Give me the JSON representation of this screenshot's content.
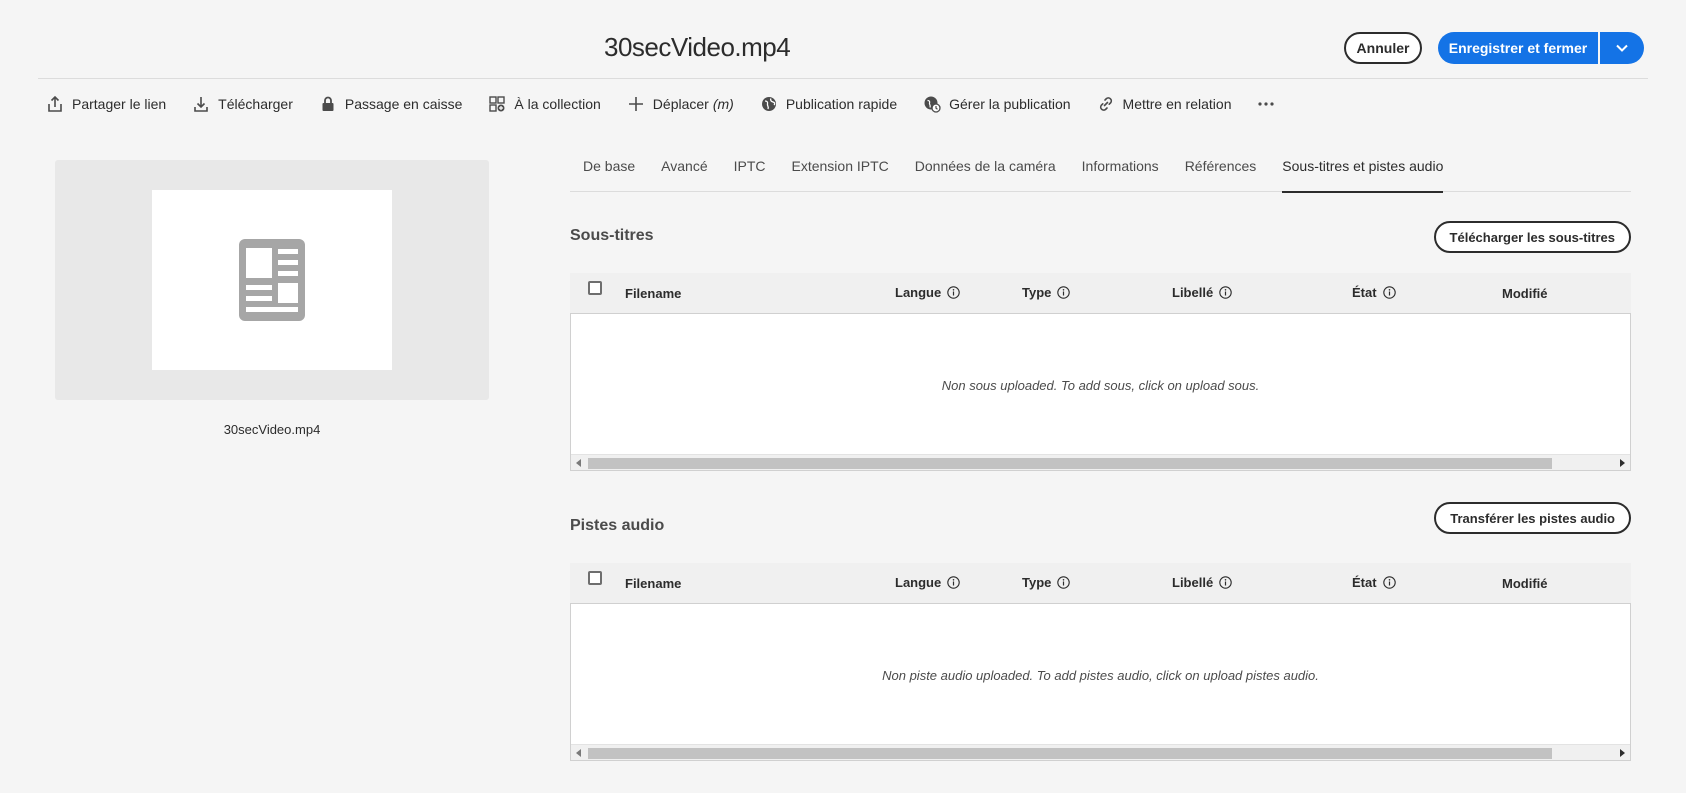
{
  "header": {
    "title": "30secVideo.mp4",
    "cancel_label": "Annuler",
    "save_label": "Enregistrer et fermer"
  },
  "toolbar": {
    "items": [
      {
        "label": "Partager le lien",
        "icon": "share-icon"
      },
      {
        "label": "Télécharger",
        "icon": "download-icon"
      },
      {
        "label": "Passage en caisse",
        "icon": "lock-icon"
      },
      {
        "label": "À la collection",
        "icon": "collection-add-icon"
      },
      {
        "label": "Déplacer",
        "shortcut": "(m)",
        "icon": "move-icon"
      },
      {
        "label": "Publication rapide",
        "icon": "globe-icon"
      },
      {
        "label": "Gérer la publication",
        "icon": "globe-clock-icon"
      },
      {
        "label": "Mettre en relation",
        "icon": "link-icon"
      }
    ],
    "more_icon": "more-icon"
  },
  "preview": {
    "filename": "30secVideo.mp4",
    "icon": "document-icon"
  },
  "tabs": [
    {
      "label": "De base"
    },
    {
      "label": "Avancé"
    },
    {
      "label": "IPTC"
    },
    {
      "label": "Extension IPTC"
    },
    {
      "label": "Données de la caméra"
    },
    {
      "label": "Informations"
    },
    {
      "label": "Références"
    },
    {
      "label": "Sous-titres et pistes audio",
      "active": true
    }
  ],
  "subtitles": {
    "title": "Sous-titres",
    "upload_label": "Télécharger les sous-titres",
    "columns": [
      "Filename",
      "Langue",
      "Type",
      "Libellé",
      "État",
      "Modifié"
    ],
    "empty_message": "Non sous uploaded. To add sous, click on upload sous."
  },
  "audio": {
    "title": "Pistes audio",
    "upload_label": "Transférer les pistes audio",
    "columns": [
      "Filename",
      "Langue",
      "Type",
      "Libellé",
      "État",
      "Modifié"
    ],
    "empty_message": "Non piste audio uploaded. To add pistes audio, click on upload pistes audio."
  },
  "colors": {
    "accent": "#1473e6",
    "background": "#f5f5f5",
    "text": "#2c2c2c"
  }
}
